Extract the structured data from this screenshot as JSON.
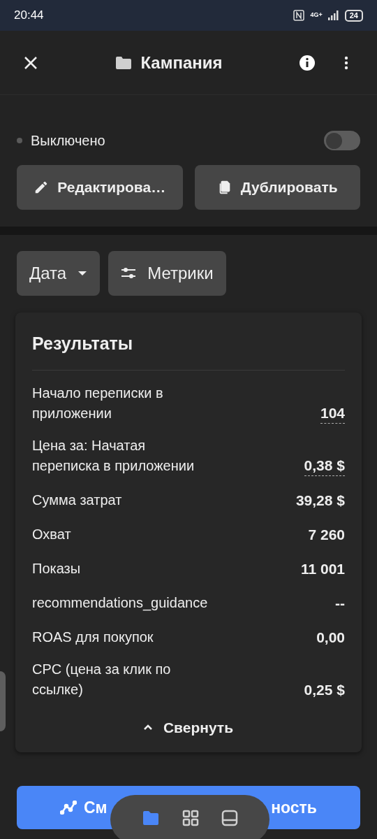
{
  "status_bar": {
    "time": "20:44",
    "battery": "24",
    "network": "4G+"
  },
  "header": {
    "title": "Кампания"
  },
  "campaign": {
    "status": "Выключено",
    "on": false
  },
  "actions": [
    {
      "label": "Редактирова…",
      "kind": "edit"
    },
    {
      "label": "Дублировать",
      "kind": "duplicate"
    }
  ],
  "filters": [
    {
      "label": "Дата",
      "kind": "dropdown"
    },
    {
      "label": "Метрики",
      "kind": "sliders"
    }
  ],
  "results": {
    "title": "Результаты",
    "rows": [
      {
        "label": "Начало переписки в приложении",
        "value": "104",
        "underlined": true
      },
      {
        "label": "Цена за: Начатая переписка в приложении",
        "value": "0,38 $",
        "underlined": true
      },
      {
        "label": "Сумма затрат",
        "value": "39,28 $",
        "underlined": false
      },
      {
        "label": "Охват",
        "value": "7 260",
        "underlined": false
      },
      {
        "label": "Показы",
        "value": "11 001",
        "underlined": false
      },
      {
        "label": "recommendations_guidance",
        "value": "--",
        "underlined": false
      },
      {
        "label": "ROAS для покупок",
        "value": "0,00",
        "underlined": false
      },
      {
        "label": "CPC (цена за клик по ссылке)",
        "value": "0,25 $",
        "underlined": false
      }
    ],
    "collapse": "Свернуть"
  },
  "primary_button": {
    "label_start": "См",
    "label_end": "ность"
  },
  "bottom_nav": [
    {
      "kind": "folder",
      "selected": true
    },
    {
      "kind": "grid",
      "selected": false
    },
    {
      "kind": "screen",
      "selected": false
    }
  ]
}
